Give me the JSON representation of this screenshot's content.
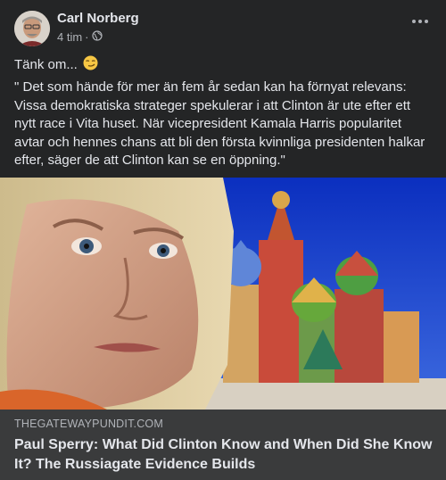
{
  "post": {
    "author": "Carl Norberg",
    "time": "4 tim",
    "audience_icon": "globe-icon",
    "intro": "Tänk om...",
    "intro_emoji": "smirk-emoji-icon",
    "body": "\" Det som hände för mer än fem år sedan kan ha förnyat relevans:\nVissa demokratiska strateger  spekulerar  i att Clinton är ute efter ett nytt race i Vita huset. När vicepresident Kamala Harris popularitet avtar och hennes chans att bli den första kvinnliga presidenten halkar efter, säger de att Clinton kan se en öppning.\""
  },
  "link_preview": {
    "domain": "THEGATEWAYPUNDIT.COM",
    "headline": "Paul Sperry: What Did Clinton Know and When Did She Know It? The Russiagate Evidence Builds"
  },
  "colors": {
    "background": "#242526",
    "link_card": "#3a3b3c",
    "text_primary": "#e4e6eb",
    "text_secondary": "#b0b3b8"
  }
}
